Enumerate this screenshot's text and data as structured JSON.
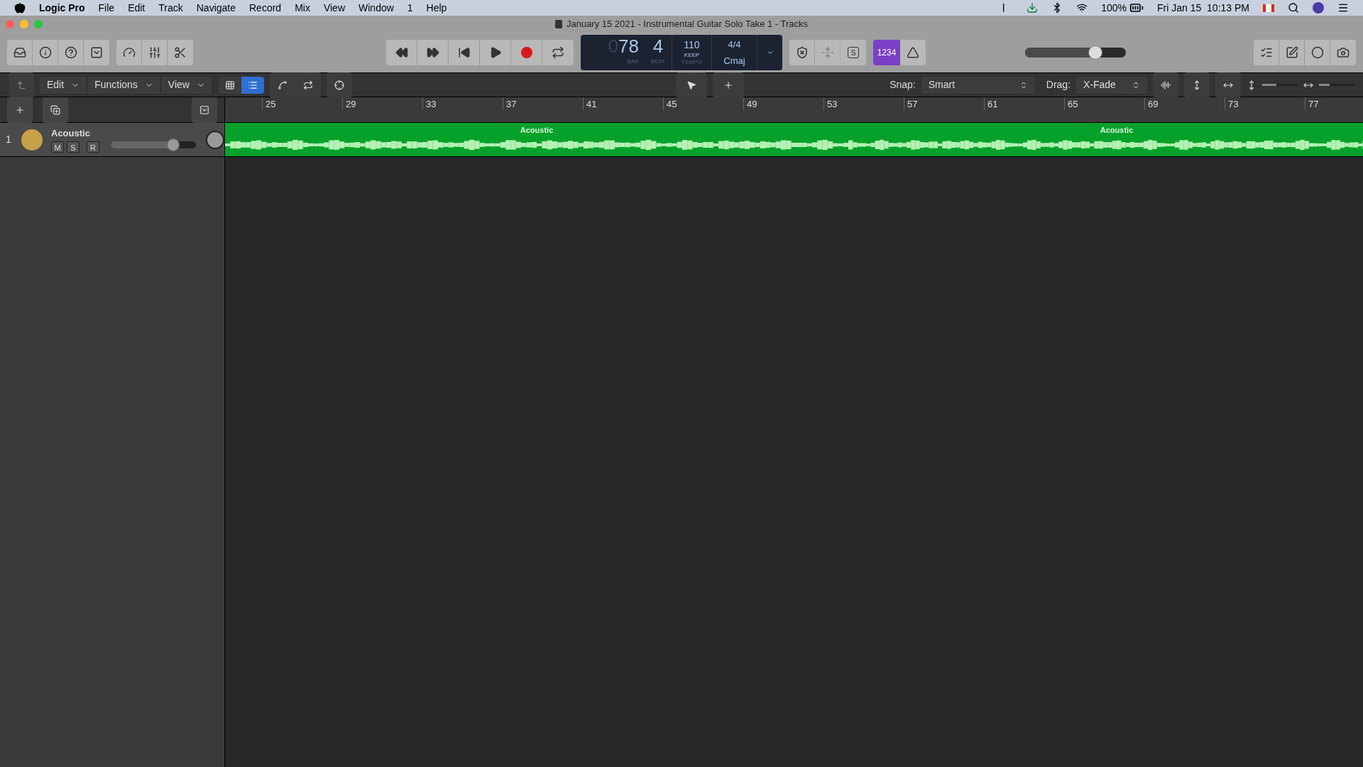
{
  "menu_bar": {
    "app": "Logic Pro",
    "items": [
      "File",
      "Edit",
      "Track",
      "Navigate",
      "Record",
      "Mix",
      "View",
      "Window",
      "1",
      "Help"
    ],
    "battery": "100%",
    "clock": "Fri Jan 15  10:13 PM"
  },
  "window": {
    "title": "January 15 2021 - Instrumental Guitar Solo Take 1 - Tracks"
  },
  "lcd": {
    "bar_prefix": "0",
    "bar": "78",
    "beat": "4",
    "bar_label": "BAR",
    "beat_label": "BEAT",
    "tempo": "110",
    "tempo_mode": "KEEP",
    "tempo_label": "TEMPO",
    "signature": "4/4",
    "key": "Cmaj"
  },
  "solo_mode": {
    "label": "S"
  },
  "count_in": {
    "label": "1234",
    "on": true
  },
  "master_volume": {
    "level": 0.7
  },
  "local_menus": [
    "Edit",
    "Functions",
    "View"
  ],
  "view_toggles": [
    {
      "kind": "grid",
      "selected": false
    },
    {
      "kind": "list",
      "selected": true
    }
  ],
  "snap": {
    "label": "Snap:",
    "value": "Smart"
  },
  "drag": {
    "label": "Drag:",
    "value": "X-Fade"
  },
  "zoom": {
    "vertical": {
      "level": 0.4
    },
    "horizontal": {
      "level": 0.3
    }
  },
  "ruler": [
    "25",
    "29",
    "33",
    "37",
    "41",
    "45",
    "49",
    "53",
    "57",
    "61",
    "65",
    "69",
    "73",
    "77"
  ],
  "tracks": [
    {
      "number": "1",
      "name": "Acoustic",
      "mute": false,
      "solo": false,
      "record": false,
      "volume": {
        "level": 0.73
      },
      "regions": [
        {
          "name": "Acoustic"
        },
        {
          "name": "Acoustic"
        }
      ],
      "buttons": [
        "M",
        "S",
        "R"
      ]
    }
  ]
}
